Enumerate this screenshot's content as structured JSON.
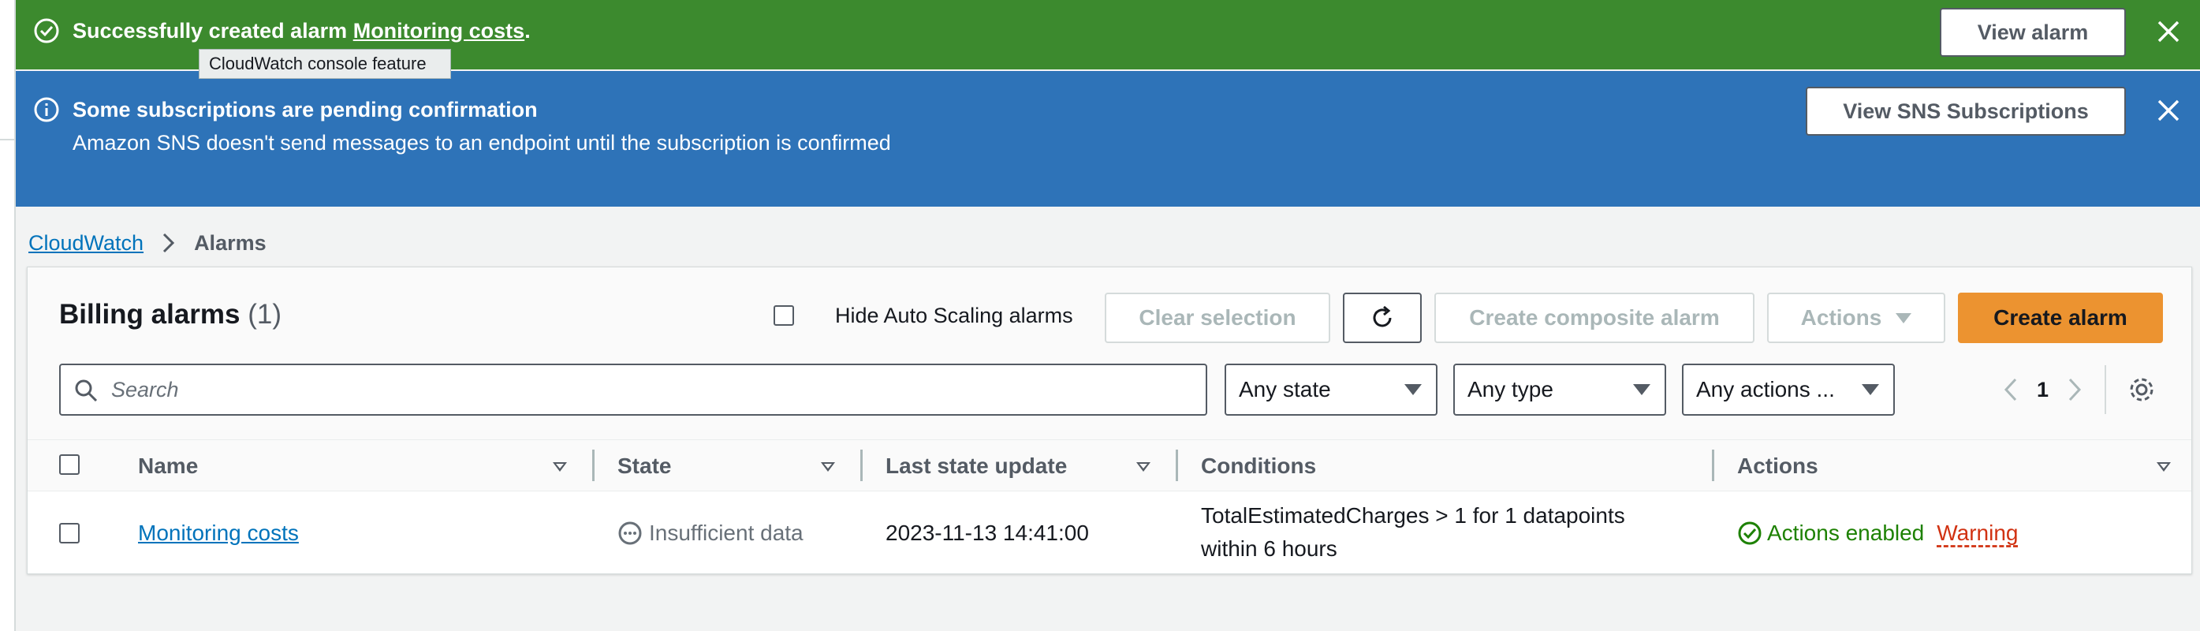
{
  "flash_success": {
    "prefix": "Successfully created alarm ",
    "alarm_link": "Monitoring costs",
    "suffix": ".",
    "button": "View alarm",
    "tooltip": "CloudWatch console feature"
  },
  "flash_info": {
    "title": "Some subscriptions are pending confirmation",
    "description": "Amazon SNS doesn't send messages to an endpoint until the subscription is confirmed",
    "button": "View SNS Subscriptions"
  },
  "breadcrumb": {
    "root": "CloudWatch",
    "current": "Alarms"
  },
  "panel": {
    "title": "Billing alarms",
    "count": "(1)",
    "hide_autoscaling_label": "Hide Auto Scaling alarms",
    "clear_selection": "Clear selection",
    "create_composite": "Create composite alarm",
    "actions": "Actions",
    "create_alarm": "Create alarm"
  },
  "filters": {
    "search_placeholder": "Search",
    "state": "Any state",
    "type": "Any type",
    "actions": "Any actions ...",
    "page": "1"
  },
  "table": {
    "headers": {
      "name": "Name",
      "state": "State",
      "last_update": "Last state update",
      "conditions": "Conditions",
      "actions": "Actions"
    },
    "rows": [
      {
        "name": "Monitoring costs",
        "state": "Insufficient data",
        "last_update": "2023-11-13 14:41:00",
        "conditions_line1": "TotalEstimatedCharges > 1 for 1 datapoints",
        "conditions_line2": "within 6 hours",
        "actions_status": "Actions enabled",
        "actions_warning": "Warning"
      }
    ]
  },
  "colors": {
    "success": "#3c8a2e",
    "info": "#2e73b8",
    "link": "#0073bb",
    "primary": "#ec9330",
    "warning": "#d13212",
    "ok": "#1d8102"
  }
}
